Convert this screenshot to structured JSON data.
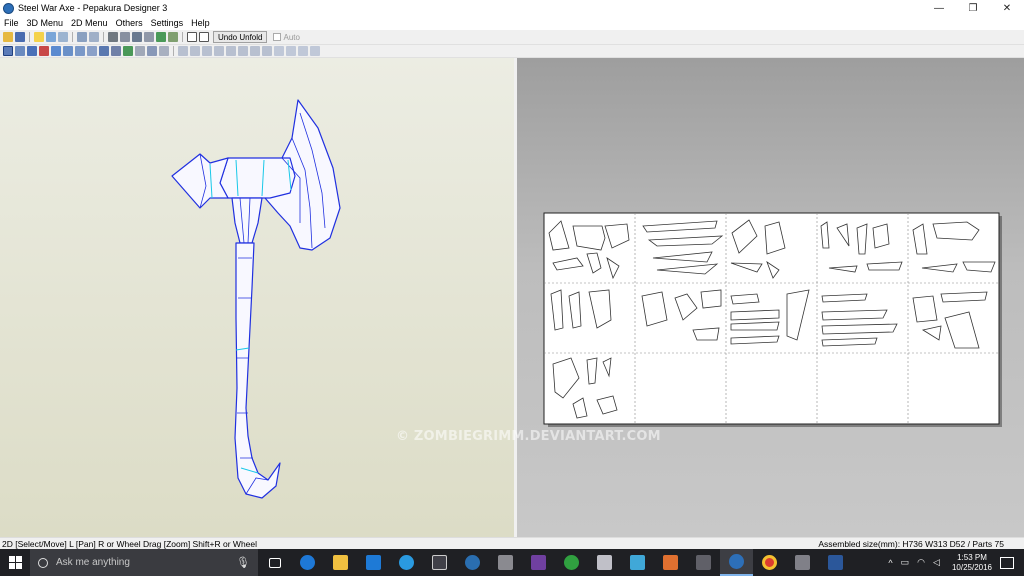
{
  "window": {
    "title": "Steel War Axe - Pepakura Designer 3",
    "controls": [
      "—",
      "❐",
      "✕"
    ]
  },
  "menu": [
    "File",
    "3D Menu",
    "2D Menu",
    "Others",
    "Settings",
    "Help"
  ],
  "toolbar": {
    "undo_unfold": "Undo Unfold",
    "auto": "Auto"
  },
  "watermark": "© ZOMBIEGRIMM.DEVIANTART.COM",
  "status": {
    "left": "2D [Select/Move] L [Pan] R or Wheel Drag [Zoom] Shift+R or Wheel",
    "right": "Assembled size(mm): H736 W313 D52 / Parts 75"
  },
  "taskbar": {
    "search_placeholder": "Ask me anything",
    "time": "1:53 PM",
    "date": "10/25/2016"
  },
  "colors": {
    "model_blue": "#2030e0",
    "model_cyan": "#18c8e8",
    "taskbar": "#1f2024"
  }
}
